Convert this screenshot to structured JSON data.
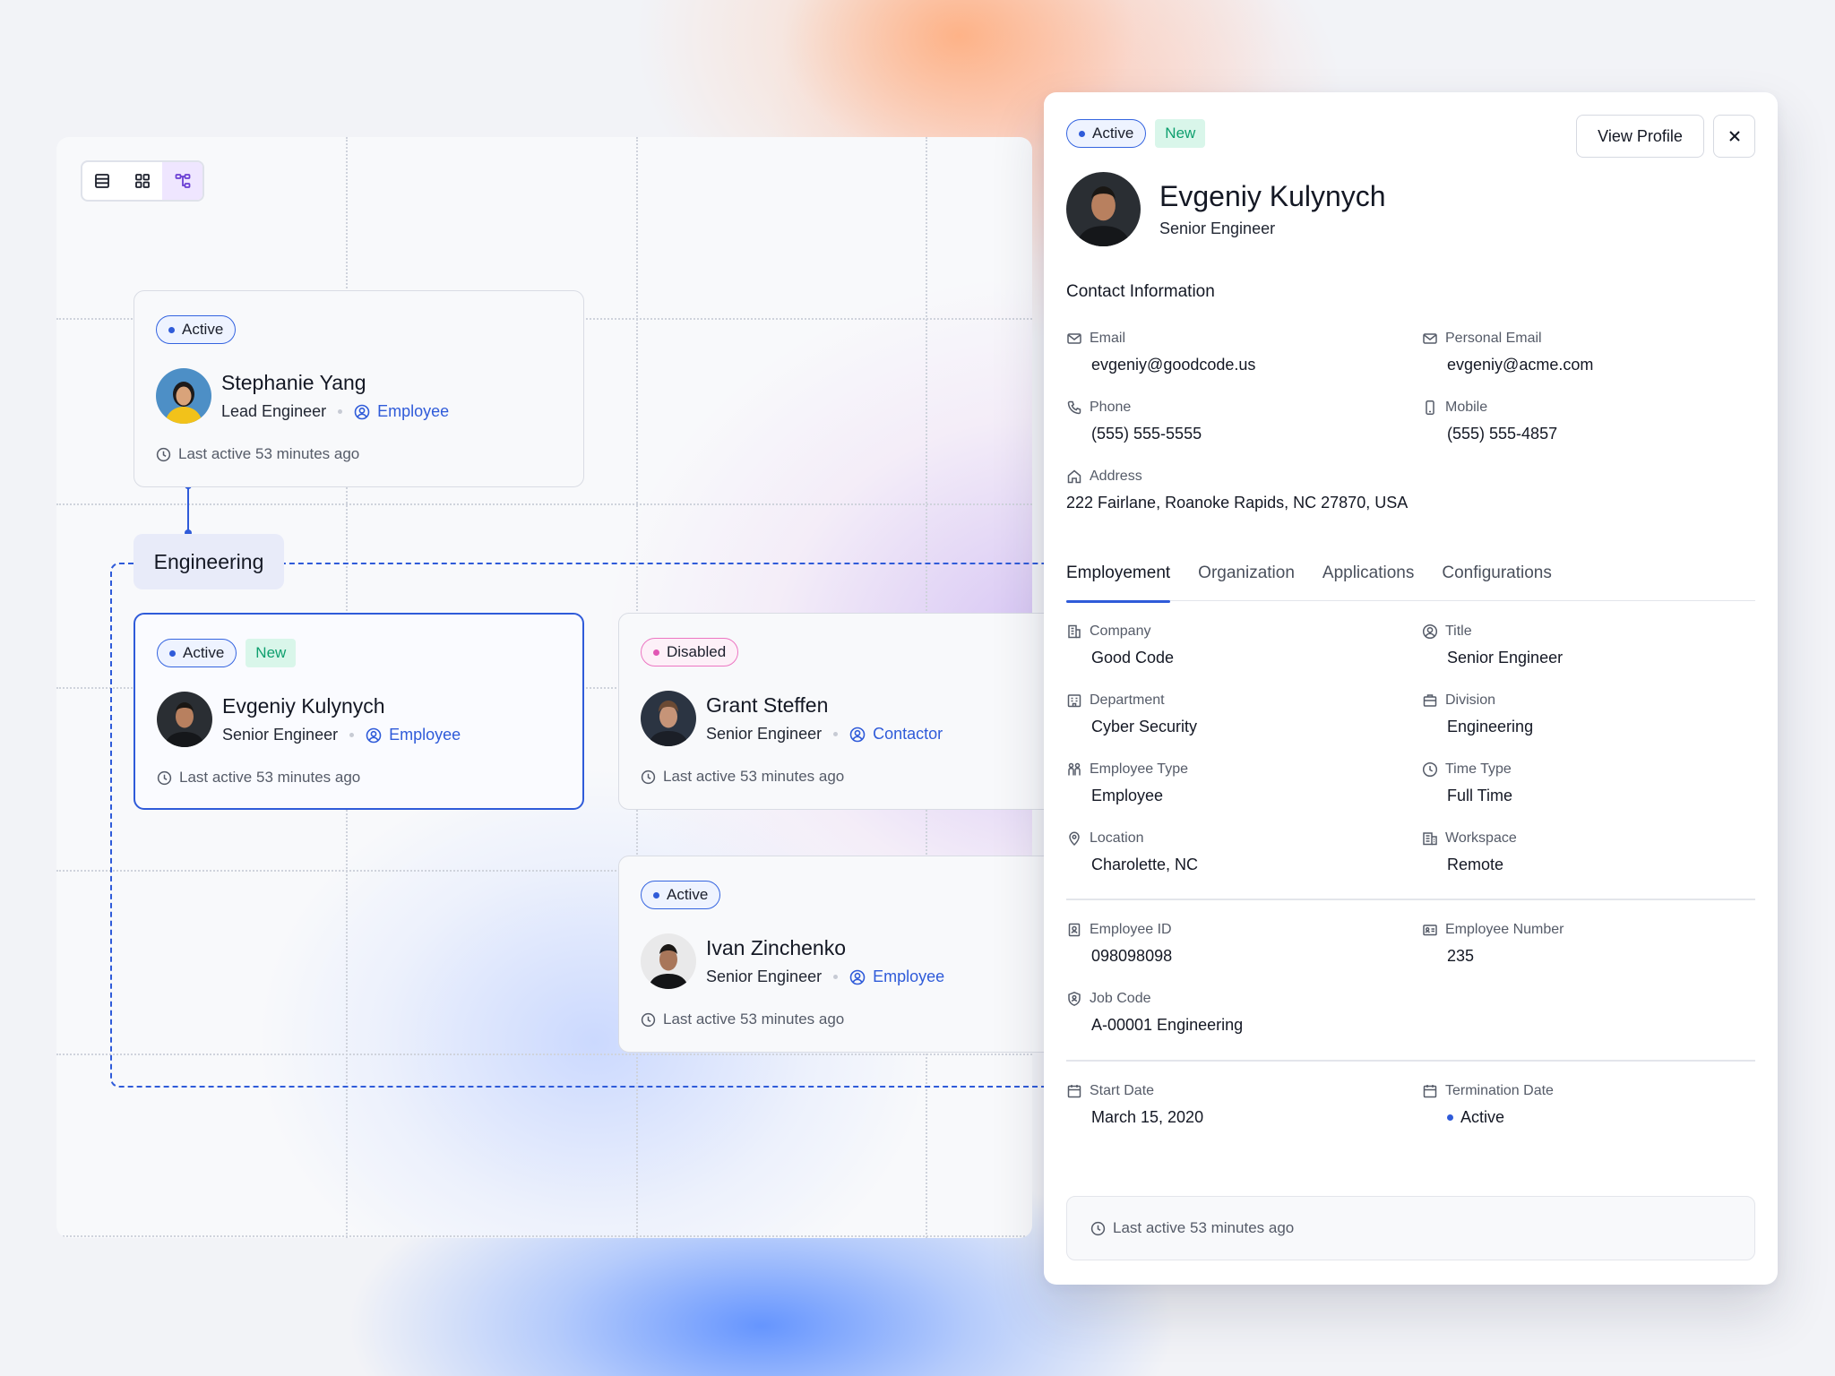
{
  "view_switch": {
    "items": [
      "list-view",
      "grid-view",
      "org-chart-view"
    ],
    "active": "org-chart-view"
  },
  "org": {
    "lead": {
      "badges": [
        "Active"
      ],
      "name": "Stephanie Yang",
      "title": "Lead Engineer",
      "role": "Employee",
      "last_active": "Last active 53 minutes ago"
    },
    "group_label": "Engineering",
    "members": [
      {
        "badges": [
          "Active",
          "New"
        ],
        "name": "Evgeniy Kulynych",
        "title": "Senior Engineer",
        "role": "Employee",
        "last_active": "Last active 53 minutes ago"
      },
      {
        "badges": [
          "Disabled"
        ],
        "name": "Grant Steffen",
        "title": "Senior Engineer",
        "role": "Contactor",
        "last_active": "Last active 53 minutes ago"
      },
      {
        "badges": [
          "Active"
        ],
        "name": "Ivan Zinchenko",
        "title": "Senior Engineer",
        "role": "Employee",
        "last_active": "Last active 53 minutes ago"
      }
    ]
  },
  "panel": {
    "badges": [
      "Active",
      "New"
    ],
    "view_profile": "View Profile",
    "name": "Evgeniy Kulynych",
    "title": "Senior Engineer",
    "contact_heading": "Contact Information",
    "contact": {
      "email_label": "Email",
      "email": "evgeniy@goodcode.us",
      "personal_email_label": "Personal Email",
      "personal_email": "evgeniy@acme.com",
      "phone_label": "Phone",
      "phone": "(555) 555-5555",
      "mobile_label": "Mobile",
      "mobile": "(555) 555-4857",
      "address_label": "Address",
      "address": "222 Fairlane, Roanoke Rapids, NC 27870, USA"
    },
    "tabs": [
      "Employement",
      "Organization",
      "Applications",
      "Configurations"
    ],
    "active_tab": "Employement",
    "employment": {
      "company_label": "Company",
      "company": "Good Code",
      "title_label": "Title",
      "title": "Senior Engineer",
      "department_label": "Department",
      "department": "Cyber Security",
      "division_label": "Division",
      "division": "Engineering",
      "employee_type_label": "Employee Type",
      "employee_type": "Employee",
      "time_type_label": "Time Type",
      "time_type": "Full Time",
      "location_label": "Location",
      "location": "Charolette, NC",
      "workspace_label": "Workspace",
      "workspace": "Remote",
      "employee_id_label": "Employee ID",
      "employee_id": "098098098",
      "employee_number_label": "Employee Number",
      "employee_number": "235",
      "job_code_label": "Job Code",
      "job_code": "A-00001 Engineering",
      "start_date_label": "Start Date",
      "start_date": "March 15, 2020",
      "termination_date_label": "Termination Date",
      "termination_date": "Active"
    },
    "last_active": "Last active 53 minutes ago"
  },
  "colors": {
    "accent": "#2f5bd9",
    "new_badge": "#0e9f6e",
    "disabled_badge": "#e156b4",
    "selected_view": "#efe6ff"
  }
}
